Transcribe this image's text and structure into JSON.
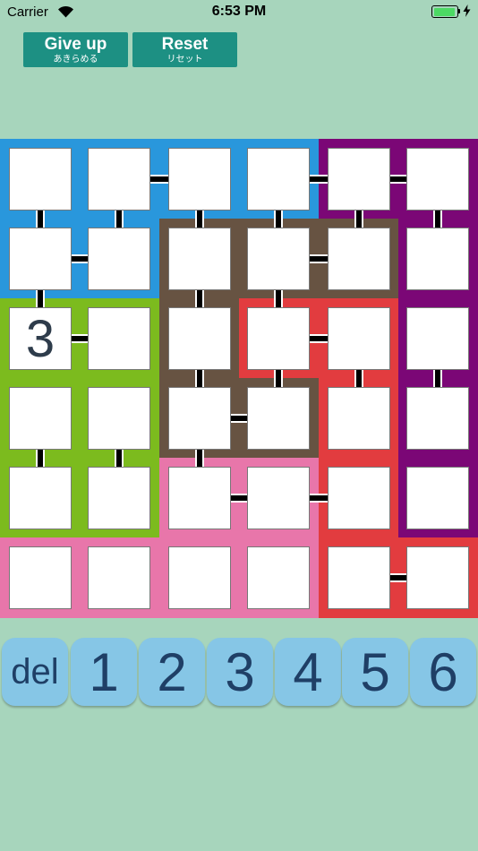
{
  "status_bar": {
    "carrier": "Carrier",
    "time": "6:53 PM",
    "battery_fraction": 0.95
  },
  "buttons": {
    "give_up": {
      "label": "Give up",
      "sublabel": "あきらめる"
    },
    "reset": {
      "label": "Reset",
      "sublabel": "リセット"
    }
  },
  "colors": {
    "background": "#a7d5bc",
    "button": "#1d9083",
    "key": "#86c6e6",
    "key_text": "#1f3f66",
    "digit": "#2e3c4b",
    "regions": {
      "blue": "#2997dc",
      "purple": "#7b0776",
      "brown": "#675342",
      "green": "#7cbb1e",
      "red": "#e23c3f",
      "pink": "#e876aa"
    }
  },
  "grid": {
    "size": 6,
    "regions": [
      [
        "blue",
        "blue",
        "blue",
        "blue",
        "purple",
        "purple"
      ],
      [
        "blue",
        "blue",
        "brown",
        "brown",
        "brown",
        "purple"
      ],
      [
        "green",
        "green",
        "brown",
        "red",
        "red",
        "purple"
      ],
      [
        "green",
        "green",
        "brown",
        "brown",
        "red",
        "purple"
      ],
      [
        "green",
        "green",
        "pink",
        "pink",
        "red",
        "purple"
      ],
      [
        "pink",
        "pink",
        "pink",
        "pink",
        "red",
        "red"
      ]
    ],
    "values": [
      [
        "",
        "",
        "",
        "",
        "",
        ""
      ],
      [
        "",
        "",
        "",
        "",
        "",
        ""
      ],
      [
        "3",
        "",
        "",
        "",
        "",
        ""
      ],
      [
        "",
        "",
        "",
        "",
        "",
        ""
      ],
      [
        "",
        "",
        "",
        "",
        "",
        ""
      ],
      [
        "",
        "",
        "",
        "",
        "",
        ""
      ]
    ],
    "h_connectors": [
      [
        0,
        1
      ],
      [
        0,
        3
      ],
      [
        0,
        4
      ],
      [
        1,
        0
      ],
      [
        1,
        3
      ],
      [
        2,
        0
      ],
      [
        2,
        3
      ],
      [
        3,
        2
      ],
      [
        4,
        2
      ],
      [
        4,
        3
      ],
      [
        5,
        4
      ]
    ],
    "v_connectors": [
      [
        1,
        0
      ],
      [
        1,
        1
      ],
      [
        1,
        2
      ],
      [
        1,
        3
      ],
      [
        1,
        4
      ],
      [
        1,
        5
      ],
      [
        2,
        0
      ],
      [
        2,
        2
      ],
      [
        2,
        3
      ],
      [
        3,
        2
      ],
      [
        3,
        3
      ],
      [
        3,
        4
      ],
      [
        3,
        5
      ],
      [
        4,
        0
      ],
      [
        4,
        1
      ],
      [
        4,
        2
      ]
    ]
  },
  "keypad": [
    "del",
    "1",
    "2",
    "3",
    "4",
    "5",
    "6"
  ]
}
